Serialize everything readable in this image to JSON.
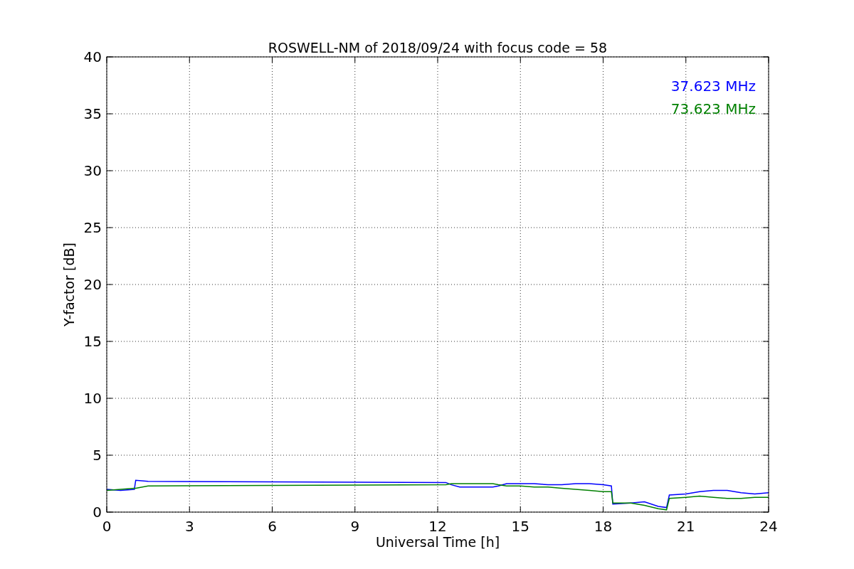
{
  "figure": {
    "chart_data": {
      "type": "line",
      "title": "ROSWELL-NM of 2018/09/24 with focus code = 58",
      "xlabel": "Universal Time [h]",
      "ylabel": "Y-factor [dB]",
      "x": [
        0,
        0.5,
        1.0,
        1.05,
        1.5,
        12.3,
        12.5,
        12.8,
        14.0,
        14.2,
        14.5,
        15,
        15.5,
        16,
        16.5,
        17,
        17.5,
        18,
        18.3,
        18.35,
        19,
        19.5,
        20,
        20.3,
        20.4,
        21,
        21.5,
        22,
        22.5,
        23,
        23.5,
        24
      ],
      "series": [
        {
          "name": "37.623 MHz",
          "color": "#0000ff",
          "values": [
            2.0,
            1.9,
            2.0,
            2.8,
            2.7,
            2.6,
            2.4,
            2.2,
            2.2,
            2.3,
            2.5,
            2.5,
            2.5,
            2.4,
            2.4,
            2.5,
            2.5,
            2.4,
            2.3,
            0.7,
            0.8,
            0.9,
            0.5,
            0.4,
            1.5,
            1.6,
            1.8,
            1.9,
            1.9,
            1.7,
            1.6,
            1.7
          ]
        },
        {
          "name": "73.623 MHz",
          "color": "#008000",
          "values": [
            1.9,
            2.0,
            2.1,
            2.1,
            2.3,
            2.4,
            2.5,
            2.5,
            2.5,
            2.4,
            2.3,
            2.3,
            2.2,
            2.2,
            2.1,
            2.0,
            1.9,
            1.8,
            1.8,
            0.8,
            0.8,
            0.6,
            0.3,
            0.2,
            1.2,
            1.3,
            1.4,
            1.3,
            1.2,
            1.2,
            1.3,
            1.3
          ]
        }
      ],
      "grid": true,
      "xlim": [
        0,
        24
      ],
      "ylim": [
        0,
        40
      ],
      "xticks": [
        0,
        3,
        6,
        9,
        12,
        15,
        18,
        21,
        24
      ],
      "yticks": [
        0,
        5,
        10,
        15,
        20,
        25,
        30,
        35,
        40
      ]
    }
  }
}
